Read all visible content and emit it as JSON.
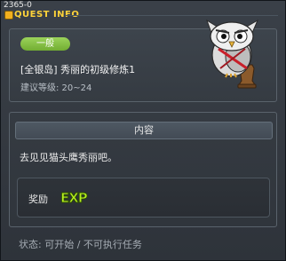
{
  "window": {
    "quest_id": "2365-0",
    "title": "QUEST INFO"
  },
  "quest": {
    "category": "一般",
    "name": "[全银岛] 秀丽的初级修炼1",
    "level_requirement": "建议等级: 20~24",
    "npc_icon": "owl-npc-icon"
  },
  "content": {
    "header": "内容",
    "description": "去见见猫头鹰秀丽吧。"
  },
  "reward": {
    "label": "奖励",
    "exp_icon_text": "EXP"
  },
  "status": {
    "text": "状态: 可开始 / 不可执行任务"
  },
  "colors": {
    "accent_title": "#ffd33a",
    "badge_green": "#84c241",
    "exp_green": "#b8f020"
  }
}
